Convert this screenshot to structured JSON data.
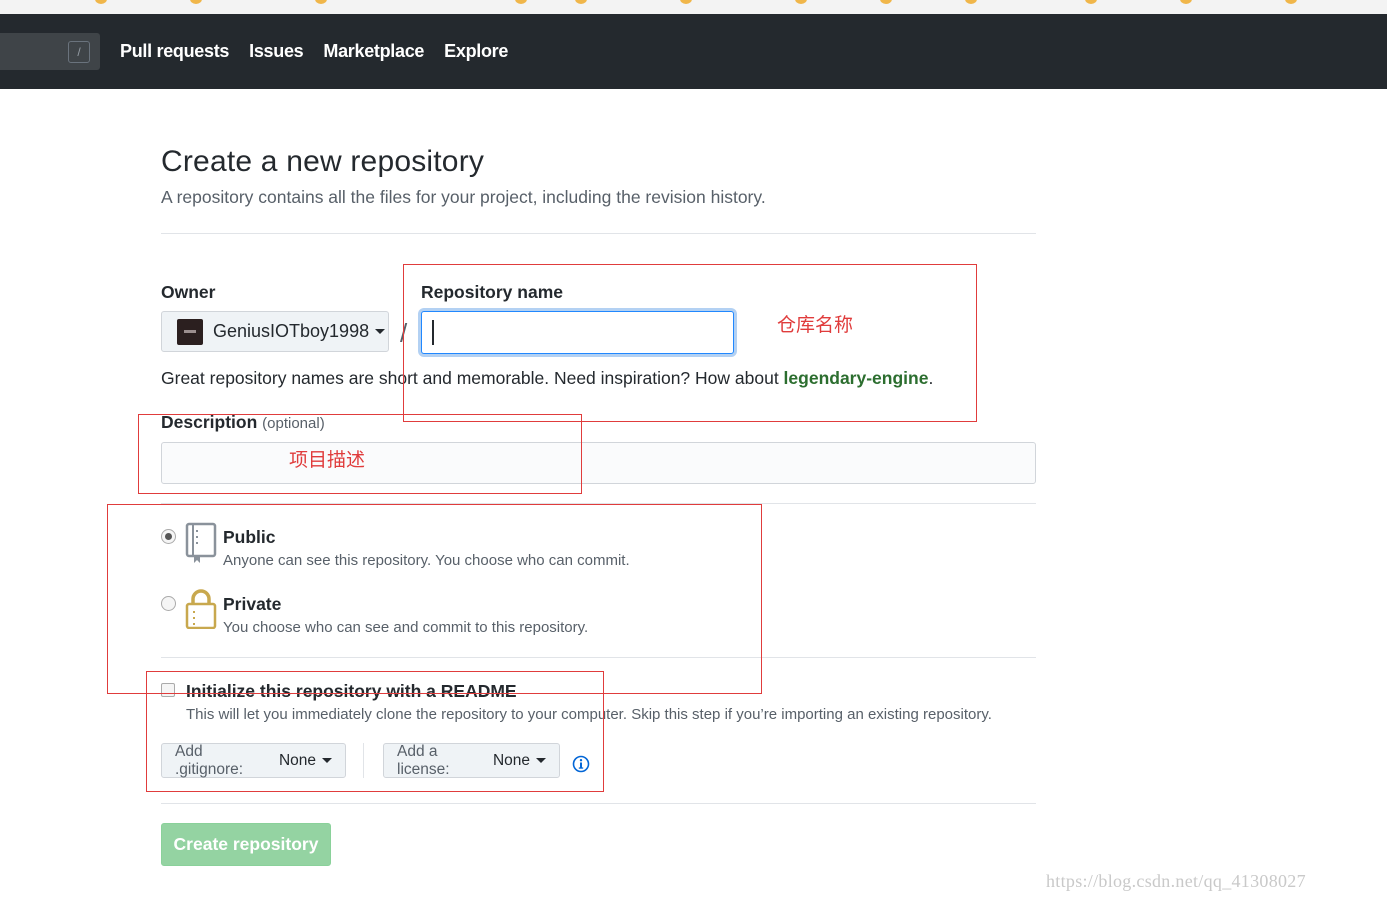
{
  "header": {
    "search_key": "/",
    "nav": [
      "Pull requests",
      "Issues",
      "Marketplace",
      "Explore"
    ]
  },
  "page": {
    "title": "Create a new repository",
    "subtitle": "A repository contains all the files for your project, including the revision history."
  },
  "owner": {
    "label": "Owner",
    "name": "GeniusIOTboy1998"
  },
  "repo": {
    "separator": "/",
    "label": "Repository name",
    "value": "",
    "hint_prefix": "Great repository names are short and memorable. Need inspiration? How about ",
    "suggestion": "legendary-engine",
    "hint_suffix": "."
  },
  "description": {
    "label": "Description",
    "optional": "(optional)",
    "value": ""
  },
  "visibility": {
    "public_title": "Public",
    "public_note": "Anyone can see this repository. You choose who can commit.",
    "private_title": "Private",
    "private_note": "You choose who can see and commit to this repository.",
    "selected": "public"
  },
  "readme": {
    "label": "Initialize this repository with a README",
    "note": "This will let you immediately clone the repository to your computer. Skip this step if you’re importing an existing repository.",
    "checked": false
  },
  "gitignore": {
    "label": "Add .gitignore:",
    "value": "None"
  },
  "license": {
    "label": "Add a license:",
    "value": "None"
  },
  "create_button": "Create repository",
  "annotations": {
    "repo_name": "仓库名称",
    "description": "项目描述",
    "color": "#e03c3c"
  },
  "watermark": "https://blog.csdn.net/qq_41308027"
}
